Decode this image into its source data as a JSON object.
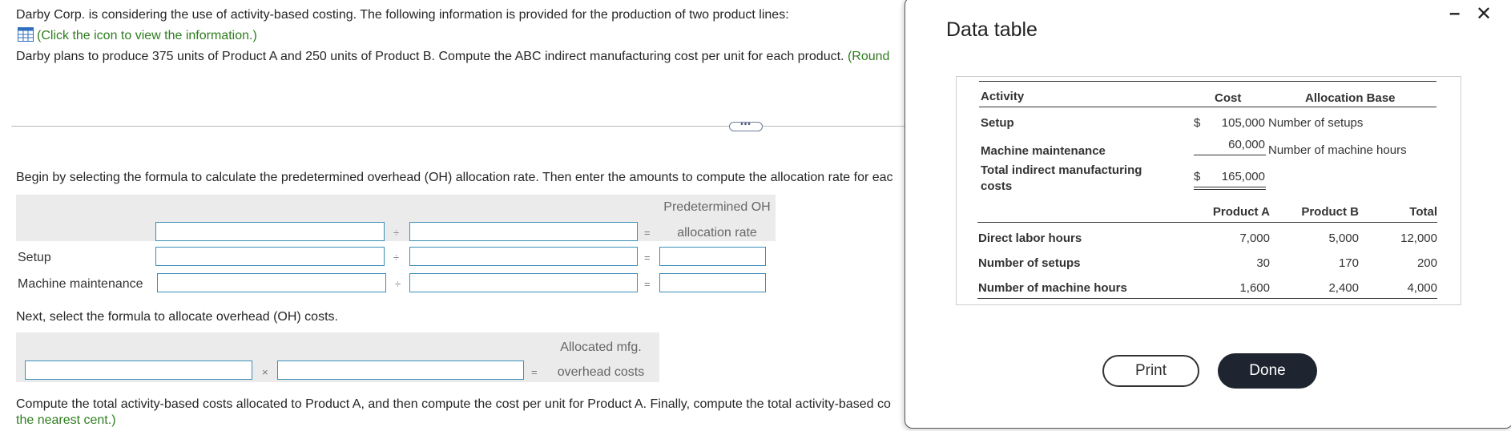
{
  "question": {
    "line1": "Darby Corp. is considering the use of activity-based costing. The following information is provided for the production of two product lines:",
    "link": "(Click the icon to view the information.)",
    "line2": "Darby plans to produce 375 units of Product A and 250 units of Product B. Compute the ABC indirect manufacturing cost per unit for each product.",
    "line2_round": "(Round",
    "step1": "Begin by selecting the formula to calculate the predetermined overhead (OH) allocation rate. Then enter the amounts to compute the allocation rate for eac",
    "rate_header_line1": "Predetermined OH",
    "rate_header_line2": "allocation rate",
    "row_setup": "Setup",
    "row_machine": "Machine maintenance",
    "step2": "Next, select the formula to allocate overhead (OH) costs.",
    "alloc_header_line1": "Allocated mfg.",
    "alloc_header_line2": "overhead costs",
    "step3": "Compute the total activity-based costs allocated to Product A, and then compute the cost per unit for Product A. Finally, compute the total activity-based co",
    "step3_cont": "the nearest cent.)",
    "divide_symbol": "÷",
    "equals_symbol": "=",
    "times_symbol": "×",
    "expander_symbol": "•••"
  },
  "dialog": {
    "title": "Data table",
    "minimize_icon": "minimize-icon",
    "close_icon": "close-icon",
    "minimize_glyph": "–",
    "close_glyph": "✕",
    "cost_table": {
      "col_activity": "Activity",
      "col_cost": "Cost",
      "col_base": "Allocation Base",
      "rows": [
        {
          "activity": "Setup",
          "dollar": "$",
          "cost": "105,000",
          "base": "Number of setups"
        },
        {
          "activity": "Machine maintenance",
          "dollar": "",
          "cost": "60,000",
          "base": "Number of machine hours"
        }
      ],
      "total_label_line1": "Total indirect manufacturing",
      "total_label_line2": "costs",
      "total_dollar": "$",
      "total_cost": "165,000"
    },
    "product_table": {
      "col_a": "Product A",
      "col_b": "Product B",
      "col_total": "Total",
      "rows": [
        {
          "label": "Direct labor hours",
          "a": "7,000",
          "b": "5,000",
          "total": "12,000"
        },
        {
          "label": "Number of setups",
          "a": "30",
          "b": "170",
          "total": "200"
        },
        {
          "label": "Number of machine hours",
          "a": "1,600",
          "b": "2,400",
          "total": "4,000"
        }
      ]
    },
    "print_label": "Print",
    "done_label": "Done"
  }
}
